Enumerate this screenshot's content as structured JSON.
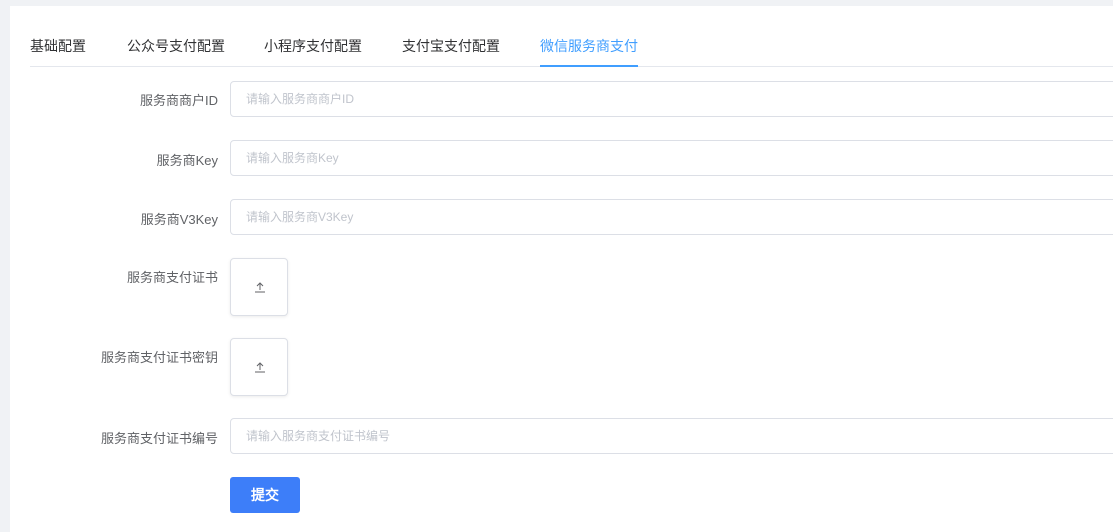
{
  "tabs": [
    {
      "label": "基础配置"
    },
    {
      "label": "公众号支付配置"
    },
    {
      "label": "小程序支付配置"
    },
    {
      "label": "支付宝支付配置"
    },
    {
      "label": "微信服务商支付"
    }
  ],
  "active_tab_index": 4,
  "form": {
    "merchant_id": {
      "label": "服务商商户ID",
      "placeholder": "请输入服务商商户ID",
      "value": ""
    },
    "key": {
      "label": "服务商Key",
      "placeholder": "请输入服务商Key",
      "value": ""
    },
    "v3key": {
      "label": "服务商V3Key",
      "placeholder": "请输入服务商V3Key",
      "value": ""
    },
    "cert": {
      "label": "服务商支付证书"
    },
    "cert_key": {
      "label": "服务商支付证书密钥"
    },
    "cert_serial": {
      "label": "服务商支付证书编号",
      "placeholder": "请输入服务商支付证书编号",
      "value": ""
    },
    "submit_label": "提交"
  },
  "colors": {
    "accent": "#409eff",
    "button": "#3d7ef9",
    "background": "#f0f2f5"
  }
}
